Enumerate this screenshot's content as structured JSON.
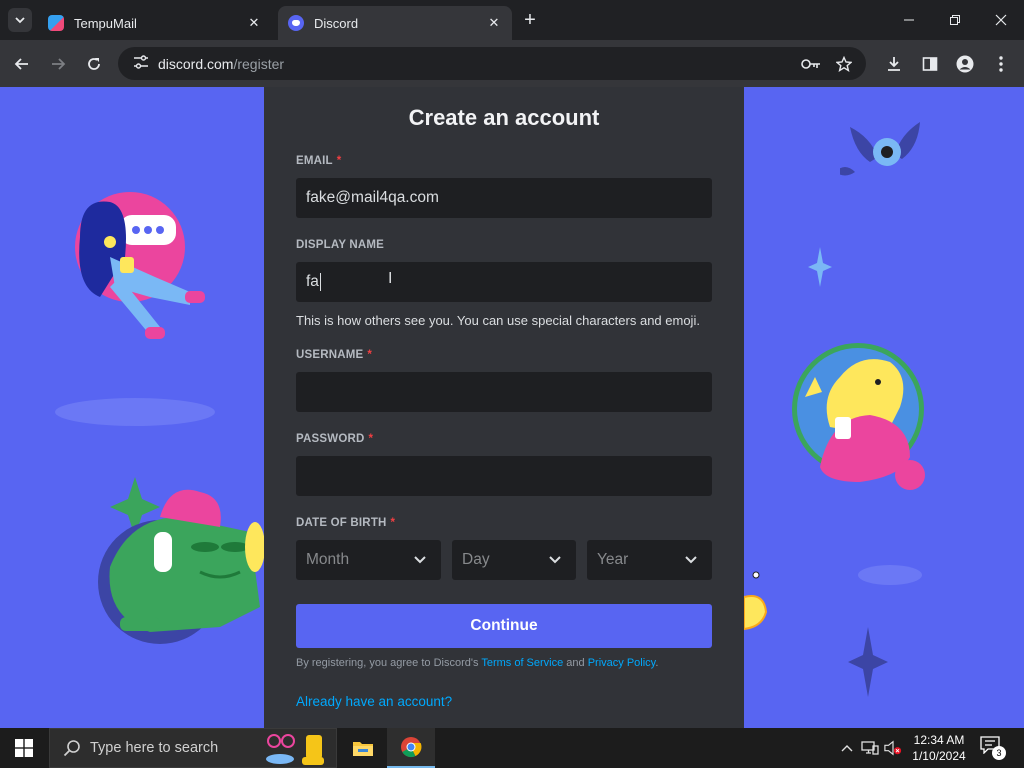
{
  "browser": {
    "tabs": [
      {
        "title": "TempuMail",
        "icon": "tempumail-favicon-icon",
        "active": false
      },
      {
        "title": "Discord",
        "icon": "discord-favicon-icon",
        "active": true
      }
    ],
    "url_domain": "discord.com",
    "url_path": "/register"
  },
  "form": {
    "title": "Create an account",
    "email_label": "EMAIL",
    "email_value": "fake@mail4qa.com",
    "display_name_label": "DISPLAY NAME",
    "display_name_value": "fa",
    "display_name_hint": "This is how others see you. You can use special characters and emoji.",
    "username_label": "USERNAME",
    "username_value": "",
    "password_label": "PASSWORD",
    "password_value": "",
    "dob_label": "DATE OF BIRTH",
    "required_marker": "*",
    "month_placeholder": "Month",
    "day_placeholder": "Day",
    "year_placeholder": "Year",
    "continue_label": "Continue",
    "terms_prefix": "By registering, you agree to Discord's ",
    "terms_link": "Terms of Service",
    "terms_and": " and ",
    "privacy_link": "Privacy Policy",
    "terms_suffix": ".",
    "login_link": "Already have an account?"
  },
  "taskbar": {
    "search_placeholder": "Type here to search",
    "time": "12:34 AM",
    "date": "1/10/2024",
    "notification_count": "3"
  },
  "colors": {
    "brand": "#5865f2",
    "card_bg": "#313338",
    "input_bg": "#1e1f22",
    "link": "#00a8fc",
    "required": "#f23f42"
  }
}
